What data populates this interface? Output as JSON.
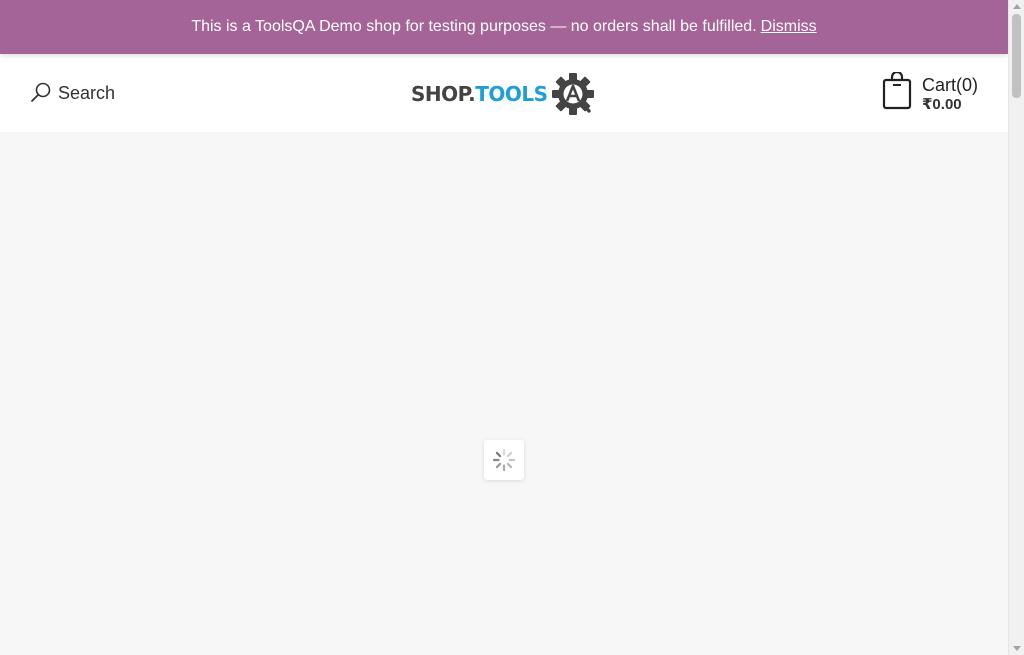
{
  "banner": {
    "message": "This is a ToolsQA Demo shop for testing purposes — no orders shall be fulfilled.",
    "dismiss_label": "Dismiss",
    "background_color": "#a46497"
  },
  "header": {
    "search": {
      "label": "Search",
      "icon": "search-icon"
    },
    "logo": {
      "shop_text": "SHOP.",
      "tools_text": "TOOLS",
      "icon": "gear-qa-icon"
    },
    "cart": {
      "icon": "shopping-bag-icon",
      "label": "Cart(0)",
      "total": "₹0.00"
    }
  },
  "content": {
    "loader_icon": "spinner-icon"
  }
}
